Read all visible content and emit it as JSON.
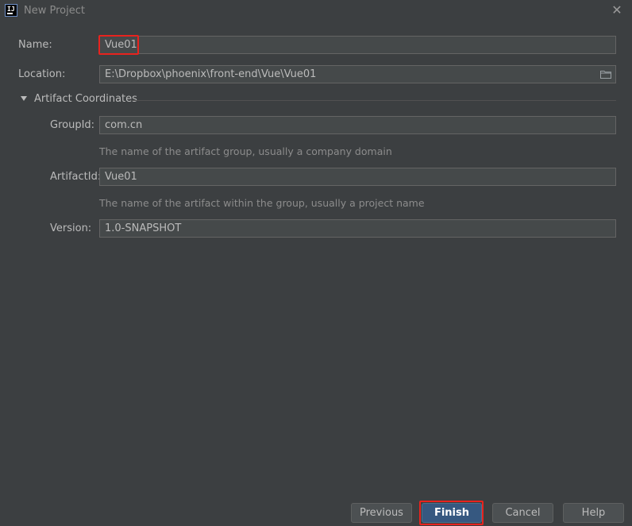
{
  "window": {
    "title": "New Project",
    "icon": "intellij-idea-icon",
    "close_icon": "close-icon"
  },
  "form": {
    "name_label": "Name:",
    "name_value": "Vue01",
    "location_label": "Location:",
    "location_value": "E:\\Dropbox\\phoenix\\front-end\\Vue\\Vue01",
    "browse_icon": "folder-icon"
  },
  "artifact": {
    "section_title": "Artifact Coordinates",
    "group_label": "GroupId:",
    "group_value": "com.cn",
    "group_hint": "The name of the artifact group, usually a company domain",
    "artifact_label": "ArtifactId:",
    "artifact_value": "Vue01",
    "artifact_hint": "The name of the artifact within the group, usually a project name",
    "version_label": "Version:",
    "version_value": "1.0-SNAPSHOT"
  },
  "buttons": {
    "previous": "Previous",
    "finish": "Finish",
    "cancel": "Cancel",
    "help": "Help"
  },
  "colors": {
    "background": "#3c3f41",
    "field_background": "#45494a",
    "primary_button": "#365880",
    "highlight": "#e8231e"
  }
}
